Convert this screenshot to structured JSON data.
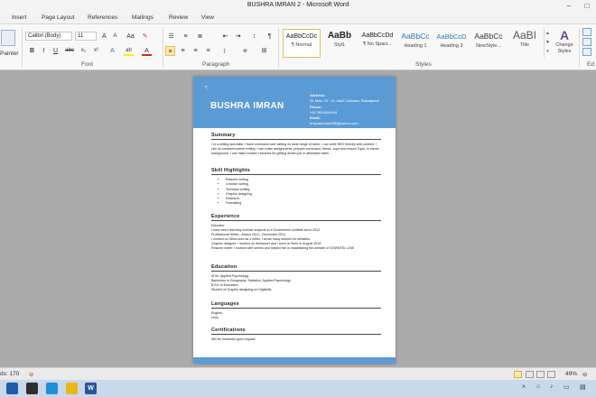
{
  "window": {
    "title": "BUSHRA IMRAN 2  -  Microsoft Word"
  },
  "tabs": [
    "Insert",
    "Page Layout",
    "References",
    "Mailings",
    "Review",
    "View"
  ],
  "ribbon": {
    "clipboard": {
      "painter_label": "Painter"
    },
    "font": {
      "font_name": "Calibri (Body)",
      "font_size": "11",
      "grow": "A",
      "shrink": "A",
      "case": "Aa",
      "bold": "B",
      "italic": "I",
      "underline": "U",
      "strike": "abc",
      "subscript": "x₂",
      "superscript": "x²",
      "text_effects": "A",
      "highlight": "ab",
      "font_color": "A",
      "group_label": "Font"
    },
    "paragraph": {
      "group_label": "Paragraph",
      "pilcrow": "¶"
    },
    "styles": {
      "group_label": "Styles",
      "items": [
        {
          "preview": "AaBbCcDc",
          "name": "¶ Normal"
        },
        {
          "preview": "AaBb",
          "name": "Styl1"
        },
        {
          "preview": "AaBbCcDd",
          "name": "¶ No Spaci..."
        },
        {
          "preview": "AaBbCc",
          "name": "Heading 1"
        },
        {
          "preview": "AaBbCcD",
          "name": "Heading 3"
        },
        {
          "preview": "AaBbCc",
          "name": "NewStyle..."
        },
        {
          "preview": "AaBI",
          "name": "Title"
        }
      ],
      "change_styles_label": "Change Styles",
      "change_icon": "A"
    },
    "editing": {
      "edit_label": "Ed"
    }
  },
  "resume": {
    "name": "BUSHRA IMRAN",
    "contact": {
      "address_label": "Address:",
      "address_value": "St. Mad. ST. 13 ,Hs#7,Gulistan, Rawalpindi",
      "phone_label": "Phone:",
      "phone_value": "+92 3000000094",
      "email_label": "Email:",
      "email_value": "bnquanimran999@yahoo.com"
    },
    "summary": {
      "heading": "Summary",
      "text": "I m a writing specialist. I have command over writing on wide range of niche. I can write SEO friendly web content. I can do creative/content writing. I can make assignments, prepare curriculum, thesis ,cope and lesson Topic, in stems background. I can make modern resumes for getting dream job in affordable rates."
    },
    "skills": {
      "heading": "Skill Highlights",
      "items": [
        "Resume writing",
        "Creative writing",
        "Technical writing",
        "Graphic designing",
        "Research",
        "Formatting"
      ]
    },
    "experience": {
      "heading": "Experience",
      "lines": [
        "Educator:",
        "I have been teaching science subjects in a Government institute since 2012.",
        "Professional Writer—March 2012—December 2014",
        "I worked on Oilms.com as a writer, I wrote many articles for websites.",
        "Graphic designer: I worked on freelancer and I work on fiverr in August 2019.",
        "Resume writer: I worked with seems and helped him in establishing the website of DOWNTEL LINE."
      ]
    },
    "education": {
      "heading": "Education",
      "lines": [
        "M.Sc. Applied Psychology",
        "Bachelors in Geography, Statistics, Applied Psychology",
        "B.Ed. in Education",
        "Student of Graphic designing on Digiskills."
      ]
    },
    "languages": {
      "heading": "Languages",
      "lines": [
        "English",
        "Urdu"
      ]
    },
    "certifications": {
      "heading": "Certifications",
      "text": "Will be furnished upon request."
    }
  },
  "status": {
    "words": "ds: 170",
    "zoom": "49%"
  },
  "colors": {
    "header_blue": "#5b9bd5",
    "ribbon_bg": "#f8f8f8",
    "workspace": "#ababab"
  }
}
